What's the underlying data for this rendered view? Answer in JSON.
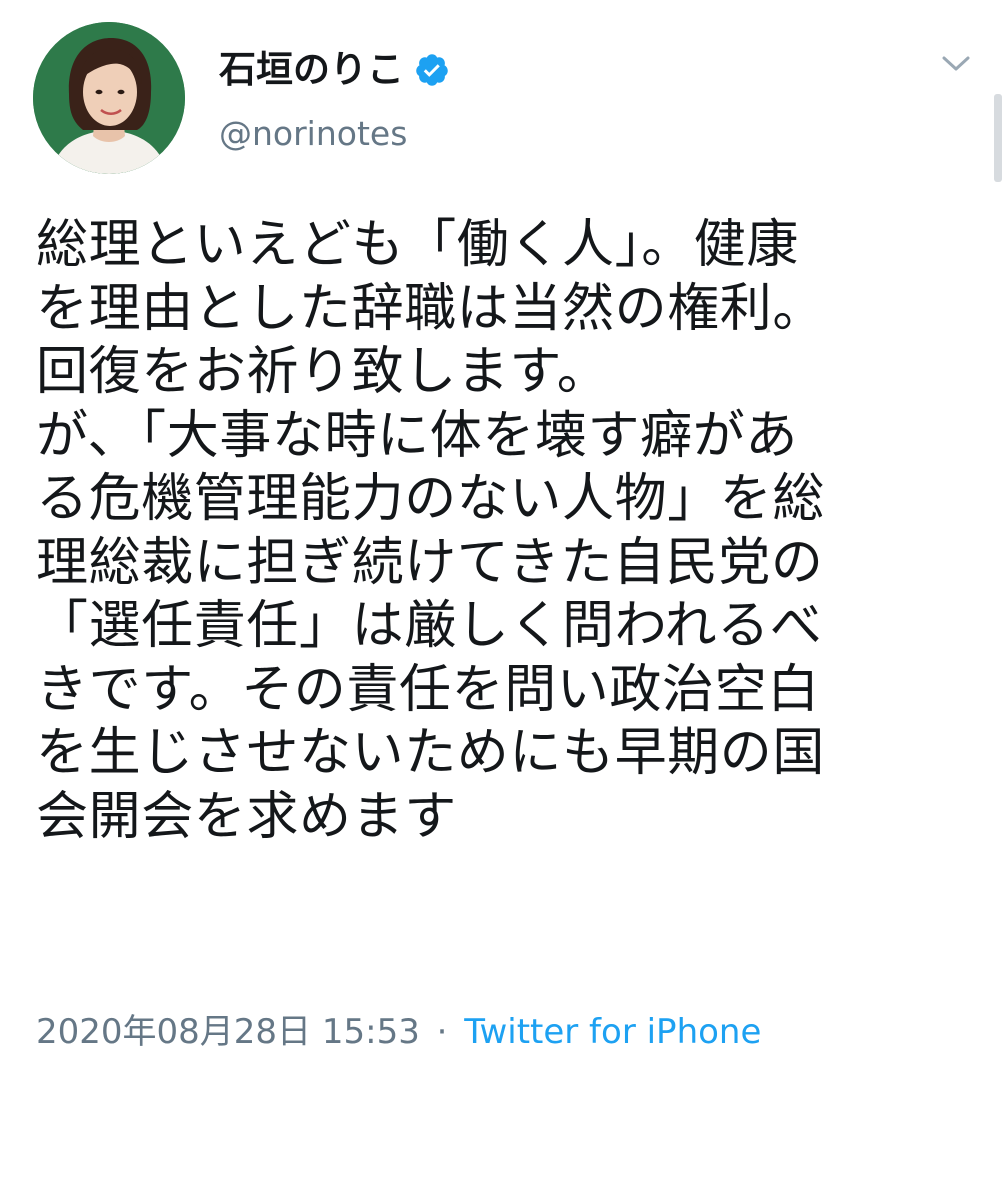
{
  "author": {
    "display_name": "石垣のりこ",
    "handle": "@norinotes",
    "verified": true,
    "avatar_icon": "profile-photo"
  },
  "tweet": {
    "lines": [
      "総理といえども「働く人」。健康",
      "を理由とした辞職は当然の権利。",
      "回復をお祈り致します。",
      "が、「大事な時に体を壊す癖があ",
      "る危機管理能力のない人物」を総",
      "理総裁に担ぎ続けてきた自民党の",
      "「選任責任」は厳しく問われるべ",
      "きです。その責任を問い政治空白",
      "を生じさせないためにも早期の国",
      "会開会を求めます"
    ]
  },
  "meta": {
    "timestamp": "2020年08月28日 15:53",
    "separator": "·",
    "source": "Twitter for iPhone"
  },
  "icons": {
    "verified": "verified-badge-icon",
    "menu": "chevron-down-icon"
  },
  "colors": {
    "text": "#14171a",
    "secondary": "#657786",
    "link": "#1da1f2",
    "verified": "#1da1f2"
  }
}
